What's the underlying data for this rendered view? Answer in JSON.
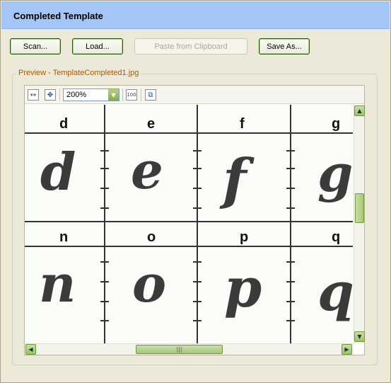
{
  "header": {
    "title": "Completed Template"
  },
  "buttons": {
    "scan": "Scan...",
    "load": "Load...",
    "paste": "Paste from Clipboard",
    "save_as": "Save As..."
  },
  "preview": {
    "label": "Preview - TemplateCompleted1.jpg",
    "zoom": "200%",
    "top_row_letters": [
      "d",
      "e",
      "f",
      "g"
    ],
    "bottom_row_letters": [
      "n",
      "o",
      "p",
      "q"
    ]
  },
  "icons": {
    "fit_width": "fit-width-icon",
    "fit_page": "fit-page-icon",
    "actual_size": "actual-size-icon",
    "copy": "copy-icon"
  },
  "colors": {
    "header_bg": "#a4c6f4",
    "window_bg": "#ece9d8",
    "label_color": "#a75a00",
    "scroll_green": "#a7c678"
  }
}
